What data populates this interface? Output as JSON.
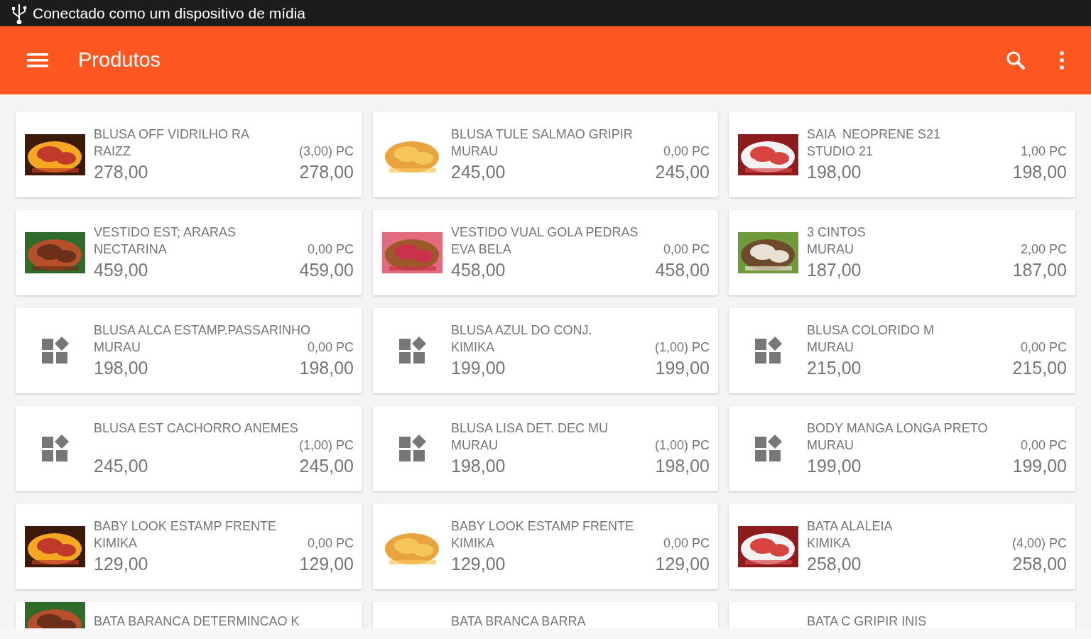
{
  "status_bar": {
    "text": "Conectado como um dispositivo de mídia"
  },
  "app_bar": {
    "title": "Produtos"
  },
  "products": [
    {
      "kind": "picture",
      "name": "BLUSA OFF VIDRILHO RA",
      "brand": "RAIZZ",
      "stock": "(3,00) PC",
      "price": "278,00",
      "total": "278,00"
    },
    {
      "kind": "picture",
      "name": "BLUSA TULE SALMAO GRIPIR",
      "brand": "MURAU",
      "stock": "0,00 PC",
      "price": "245,00",
      "total": "245,00"
    },
    {
      "kind": "picture",
      "name": "SAIA  NEOPRENE S21",
      "brand": "STUDIO 21",
      "stock": "1,00 PC",
      "price": "198,00",
      "total": "198,00"
    },
    {
      "kind": "picture",
      "name": "VESTIDO EST; ARARAS",
      "brand": "NECTARINA",
      "stock": "0,00 PC",
      "price": "459,00",
      "total": "459,00"
    },
    {
      "kind": "picture",
      "name": "VESTIDO VUAL GOLA PEDRAS",
      "brand": "EVA BELA",
      "stock": "0,00 PC",
      "price": "458,00",
      "total": "458,00"
    },
    {
      "kind": "picture",
      "name": "3 CINTOS",
      "brand": "MURAU",
      "stock": "2,00 PC",
      "price": "187,00",
      "total": "187,00"
    },
    {
      "kind": "placeholder",
      "name": "BLUSA ALCA ESTAMP.PASSARINHO",
      "brand": "MURAU",
      "stock": "0,00 PC",
      "price": "198,00",
      "total": "198,00"
    },
    {
      "kind": "placeholder",
      "name": "BLUSA AZUL DO CONJ.",
      "brand": "KIMIKA",
      "stock": "(1,00) PC",
      "price": "199,00",
      "total": "199,00"
    },
    {
      "kind": "placeholder",
      "name": "BLUSA COLORIDO M",
      "brand": "MURAU",
      "stock": "0,00 PC",
      "price": "215,00",
      "total": "215,00"
    },
    {
      "kind": "placeholder",
      "name": "BLUSA EST CACHORRO ANEMES",
      "stock": "(1,00) PC",
      "price": "245,00",
      "total": "245,00"
    },
    {
      "kind": "placeholder",
      "name": "BLUSA LISA DET. DEC MU",
      "brand": "MURAU",
      "stock": "(1,00) PC",
      "price": "198,00",
      "total": "198,00"
    },
    {
      "kind": "placeholder",
      "name": "BODY MANGA LONGA PRETO",
      "brand": "MURAU",
      "stock": "0,00 PC",
      "price": "199,00",
      "total": "199,00"
    },
    {
      "kind": "picture",
      "name": "BABY LOOK ESTAMP FRENTE",
      "brand": "KIMIKA",
      "stock": "0,00 PC",
      "price": "129,00",
      "total": "129,00"
    },
    {
      "kind": "picture",
      "name": "BABY LOOK ESTAMP FRENTE",
      "brand": "KIMIKA",
      "stock": "0,00 PC",
      "price": "129,00",
      "total": "129,00"
    },
    {
      "kind": "picture",
      "name": "BATA ALALEIA",
      "brand": "KIMIKA",
      "stock": "(4,00) PC",
      "price": "258,00",
      "total": "258,00"
    },
    {
      "kind": "picture",
      "name": "BATA BARANCA DETERMINCAO K"
    },
    {
      "name": "BATA BRANCA BARRA"
    },
    {
      "name": "BATA C GRIPIR INIS"
    }
  ]
}
